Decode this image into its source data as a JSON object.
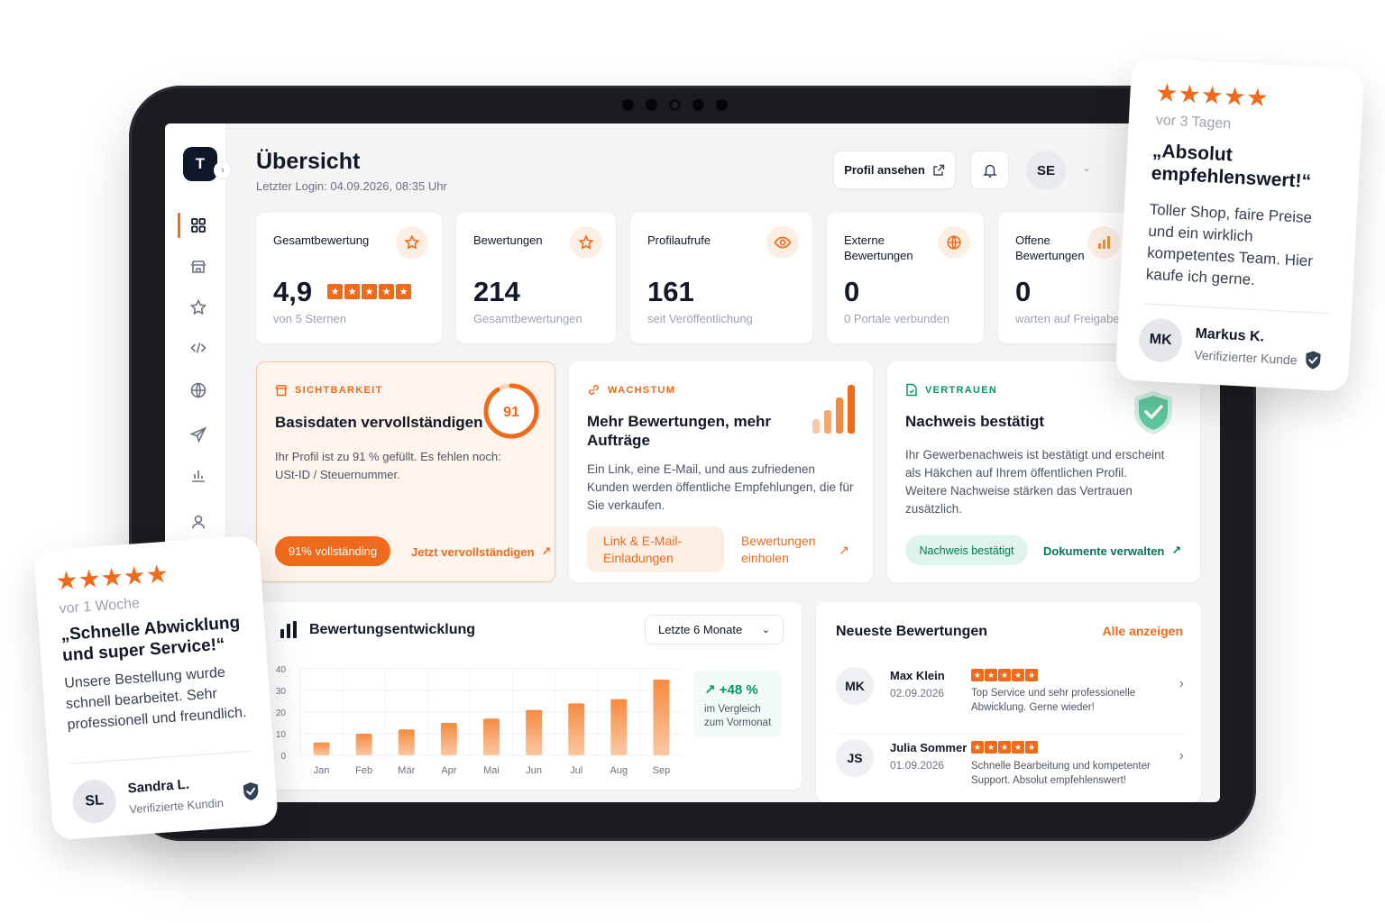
{
  "app": {
    "logo_letter": "T"
  },
  "header": {
    "title": "Übersicht",
    "last_login": "Letzter Login: 04.09.2026, 08:35 Uhr",
    "profile_button": "Profil ansehen",
    "user_initials": "SE"
  },
  "sidebar": {
    "items": [
      {
        "icon": "grid-icon",
        "active": true
      },
      {
        "icon": "store-icon",
        "active": false
      },
      {
        "icon": "star-icon",
        "active": false
      },
      {
        "icon": "code-icon",
        "active": false
      },
      {
        "icon": "globe-icon",
        "active": false
      },
      {
        "icon": "send-icon",
        "active": false
      },
      {
        "icon": "bar-chart-icon",
        "active": false
      },
      {
        "icon": "user-icon",
        "active": false
      }
    ]
  },
  "stats": [
    {
      "label": "Gesamtbewertung",
      "value": "4,9",
      "sub": "von 5 Sternen",
      "icon": "star-icon",
      "stars": 5
    },
    {
      "label": "Bewertungen",
      "value": "214",
      "sub": "Gesamtbewertungen",
      "icon": "star-icon"
    },
    {
      "label": "Profilaufrufe",
      "value": "161",
      "sub": "seit Veröffentlichung",
      "icon": "eye-icon"
    },
    {
      "label": "Externe Bewertungen",
      "value": "0",
      "sub": "0 Portale verbunden",
      "icon": "globe-icon"
    },
    {
      "label": "Offene Bewertungen",
      "value": "0",
      "sub": "warten auf Freigabe",
      "icon": "bar-chart-icon"
    }
  ],
  "cards": {
    "visibility": {
      "tag": "SICHTBARKEIT",
      "title": "Basisdaten vervollständigen",
      "text": "Ihr Profil ist zu 91 % gefüllt. Es fehlen noch: USt-ID / Steuernummer.",
      "progress_value": "91",
      "progress": 0.91,
      "pill": "91% vollständing",
      "link": "Jetzt vervollständigen"
    },
    "growth": {
      "tag": "WACHSTUM",
      "title": "Mehr Bewertungen, mehr Aufträge",
      "text": "Ein Link, eine E-Mail, und aus zufriedenen Kunden werden öffentliche Empfehlungen, die für Sie verkaufen.",
      "pill": "Link & E-Mail-Einladungen",
      "link": "Bewertungen einholen"
    },
    "trust": {
      "tag": "VERTRAUEN",
      "title": "Nachweis bestätigt",
      "text": "Ihr Gewerbenachweis ist bestätigt und erscheint als Häkchen auf Ihrem öffentlichen Profil. Weitere Nachweise stärken das Vertrauen zusätzlich.",
      "pill": "Nachweis bestätigt",
      "link": "Dokumente verwalten"
    }
  },
  "chart_panel": {
    "title": "Bewertungsentwicklung",
    "range_select": "Letzte 6 Monate",
    "trend_value": "+48 %",
    "trend_sub": "im Vergleich zum Vormonat"
  },
  "chart_data": {
    "type": "bar",
    "categories": [
      "Jan",
      "Feb",
      "Mär",
      "Apr",
      "Mai",
      "Jun",
      "Jul",
      "Aug",
      "Sep"
    ],
    "values": [
      6,
      10,
      12,
      15,
      17,
      21,
      24,
      26,
      35
    ],
    "ylim": [
      0,
      40
    ],
    "yticks": [
      0,
      10,
      20,
      30,
      40
    ],
    "grid": true,
    "color": "#f58a3f"
  },
  "reviews": {
    "title": "Neueste Bewertungen",
    "all_link": "Alle anzeigen",
    "items": [
      {
        "initials": "MK",
        "name": "Max Klein",
        "date": "02.09.2026",
        "text": "Top Service und sehr professionelle Abwicklung. Gerne wieder!"
      },
      {
        "initials": "JS",
        "name": "Julia Sommer",
        "date": "01.09.2026",
        "text": "Schnelle Bearbeitung und kompetenter Support. Absolut empfehlenswert!"
      }
    ]
  },
  "floating_reviews": [
    {
      "stars": "★★★★★",
      "ago": "vor 3 Tagen",
      "quote": "„Absolut empfehlenswert!“",
      "body": "Toller Shop, faire Preise und ein wirklich kompetentes Team. Hier kaufe ich gerne.",
      "initials": "MK",
      "name": "Markus K.",
      "verified": "Verifizierter Kunde"
    },
    {
      "stars": "★★★★★",
      "ago": "vor 1 Woche",
      "quote": "„Schnelle Abwicklung und super Service!“",
      "body": "Unsere Bestellung wurde schnell bearbeitet. Sehr professionell und freundlich.",
      "initials": "SL",
      "name": "Sandra L.",
      "verified": "Verifizierte Kundin"
    }
  ],
  "colors": {
    "accent": "#f06a1b",
    "accent_light": "#fdeee4",
    "green": "#059669",
    "dark": "#0f172a"
  }
}
